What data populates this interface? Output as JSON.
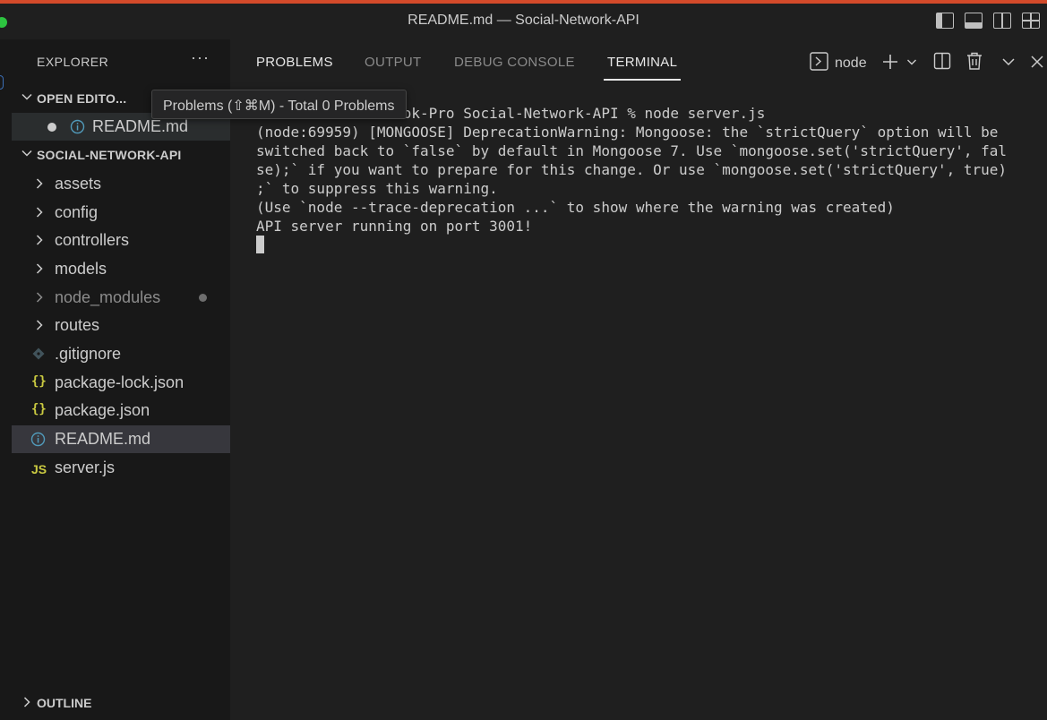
{
  "window": {
    "title": "README.md — Social-Network-API"
  },
  "explorer": {
    "header": "EXPLORER",
    "more_label": "···",
    "open_editors": {
      "label": "OPEN EDITO...",
      "items": [
        {
          "label": "README.md",
          "modified": true,
          "icon": "info-icon"
        }
      ]
    },
    "project": {
      "label": "SOCIAL-NETWORK-API",
      "items": [
        {
          "label": "assets",
          "type": "folder"
        },
        {
          "label": "config",
          "type": "folder"
        },
        {
          "label": "controllers",
          "type": "folder"
        },
        {
          "label": "models",
          "type": "folder"
        },
        {
          "label": "node_modules",
          "type": "folder",
          "dimmed": true,
          "badge": "dot"
        },
        {
          "label": "routes",
          "type": "folder"
        },
        {
          "label": ".gitignore",
          "type": "file",
          "icon": "git-icon"
        },
        {
          "label": "package-lock.json",
          "type": "file",
          "icon": "json-icon",
          "icon_text": "{}"
        },
        {
          "label": "package.json",
          "type": "file",
          "icon": "json-icon",
          "icon_text": "{}"
        },
        {
          "label": "README.md",
          "type": "file",
          "icon": "info-icon",
          "selected": true
        },
        {
          "label": "server.js",
          "type": "file",
          "icon": "js-icon",
          "icon_text": "JS"
        }
      ]
    },
    "outline_label": "OUTLINE"
  },
  "panel": {
    "tabs": [
      {
        "label": "PROBLEMS",
        "active": true
      },
      {
        "label": "OUTPUT",
        "active": false
      },
      {
        "label": "DEBUG CONSOLE",
        "active": false
      },
      {
        "label": "TERMINAL",
        "active": false,
        "underlined": true
      }
    ],
    "terminal_instance": "node",
    "terminal_lines": [
      "                 ok-Pro Social-Network-API % node server.js",
      "(node:69959) [MONGOOSE] DeprecationWarning: Mongoose: the `strictQuery` option will be",
      "switched back to `false` by default in Mongoose 7. Use `mongoose.set('strictQuery', fal",
      "se);` if you want to prepare for this change. Or use `mongoose.set('strictQuery', true)",
      ";` to suppress this warning.",
      "(Use `node --trace-deprecation ...` to show where the warning was created)",
      "API server running on port 3001!"
    ]
  },
  "tooltip": {
    "text": "Problems (⇧⌘M) - Total 0 Problems"
  },
  "colors": {
    "background": "#1f1f1f",
    "sidebar": "#181818",
    "selected_row": "#37373d",
    "text": "#cccccc",
    "json_icon": "#cbcb41",
    "info_icon": "#519aba",
    "git_icon": "#41535b"
  }
}
